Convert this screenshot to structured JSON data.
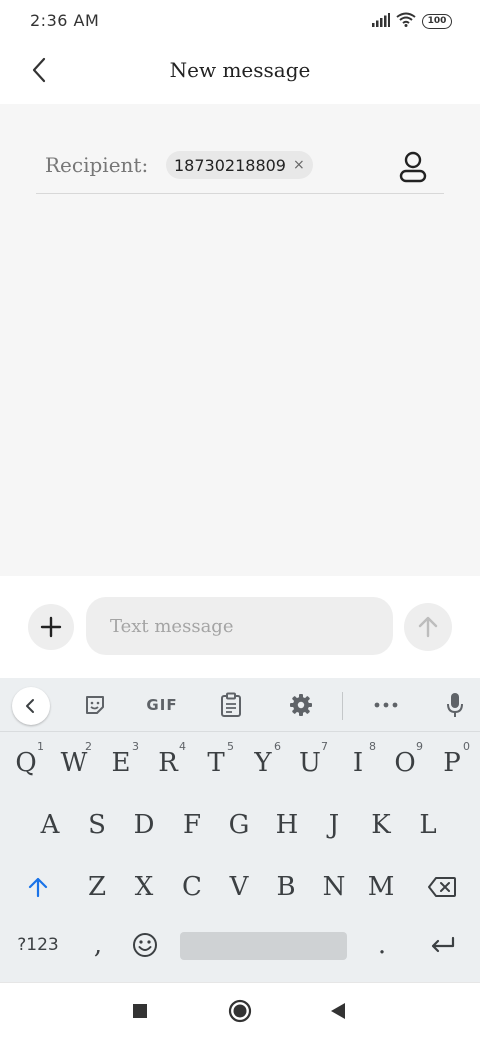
{
  "status_bar": {
    "time": "2:36 AM",
    "battery": "100",
    "icons": [
      "signal-icon",
      "wifi-icon",
      "battery-icon"
    ]
  },
  "header": {
    "title": "New message",
    "back_icon": "chevron-left-icon"
  },
  "recipient": {
    "label": "Recipient:",
    "chip_value": "18730218809",
    "chip_remove": "×",
    "contact_icon": "contact-icon"
  },
  "compose": {
    "placeholder": "Text message",
    "add_icon": "plus-icon",
    "send_icon": "arrow-up-icon"
  },
  "keyboard": {
    "toolbar": {
      "gif_label": "GIF",
      "items": [
        "collapse-icon",
        "sticker-icon",
        "gif",
        "clipboard-icon",
        "settings-icon",
        "more-icon",
        "mic-icon"
      ]
    },
    "row1": [
      {
        "label": "Q",
        "hint": "1"
      },
      {
        "label": "W",
        "hint": "2"
      },
      {
        "label": "E",
        "hint": "3"
      },
      {
        "label": "R",
        "hint": "4"
      },
      {
        "label": "T",
        "hint": "5"
      },
      {
        "label": "Y",
        "hint": "6"
      },
      {
        "label": "U",
        "hint": "7"
      },
      {
        "label": "I",
        "hint": "8"
      },
      {
        "label": "O",
        "hint": "9"
      },
      {
        "label": "P",
        "hint": "0"
      }
    ],
    "row2": [
      "A",
      "S",
      "D",
      "F",
      "G",
      "H",
      "J",
      "K",
      "L"
    ],
    "row3": [
      "Z",
      "X",
      "C",
      "V",
      "B",
      "N",
      "M"
    ],
    "row4": {
      "symbols_label": "?123",
      "comma": ",",
      "period": "."
    }
  },
  "colors": {
    "accent": "#1a73e8",
    "content_bg": "#f6f6f6",
    "keyboard_bg": "#eceff1"
  }
}
